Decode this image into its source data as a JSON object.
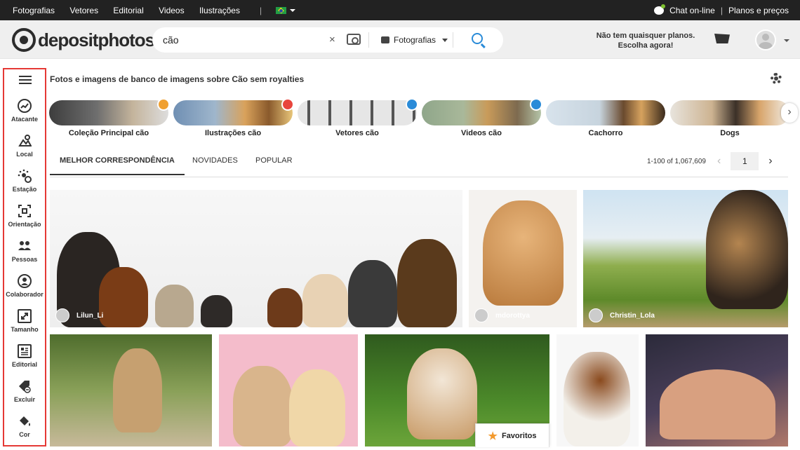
{
  "topbar": {
    "nav": [
      "Fotografias",
      "Vetores",
      "Editorial",
      "Videos",
      "Ilustrações"
    ],
    "separator": "|",
    "chat": "Chat on-line",
    "pipe": "|",
    "plans": "Planos e preços"
  },
  "header": {
    "logo": "depositphotos",
    "logo_reg": "®",
    "search_value": "cão",
    "search_clear": "×",
    "search_type": "Fotografias",
    "no_plans_line1": "Não tem quaisquer planos.",
    "no_plans_line2": "Escolha agora!"
  },
  "sidebar": {
    "items": [
      "Atacante",
      "Local",
      "Estação",
      "Orientação",
      "Pessoas",
      "Colaborador",
      "Tamanho",
      "Editorial",
      "Excluir",
      "Cor"
    ]
  },
  "page": {
    "title": "Fotos e imagens de banco de imagens sobre Cão sem royalties"
  },
  "categories": [
    {
      "label": "Coleção Principal cão",
      "badge_color": "#f0a030"
    },
    {
      "label": "Ilustrações cão",
      "badge_color": "#e8453c"
    },
    {
      "label": "Vetores cão",
      "badge_color": "#2a8bd8"
    },
    {
      "label": "Videos cão",
      "badge_color": "#2a8bd8"
    },
    {
      "label": "Cachorro",
      "badge_color": ""
    },
    {
      "label": "Dogs",
      "badge_color": ""
    }
  ],
  "tabs": [
    "MELHOR CORRESPONDÊNCIA",
    "NOVIDADES",
    "POPULAR"
  ],
  "pagination": {
    "count": "1-100 of 1,067,609",
    "page": "1",
    "prev": "‹",
    "next": "›"
  },
  "photos": {
    "authors": [
      "Lilun_Li",
      "mdorottya",
      "Christin_Lola"
    ]
  },
  "favorites": {
    "label": "Favoritos",
    "icon": "★"
  },
  "colors": {
    "topbar": "#222222",
    "header": "#efefef",
    "accent": "#2a8bd8",
    "sidebar_border": "#e53935"
  }
}
